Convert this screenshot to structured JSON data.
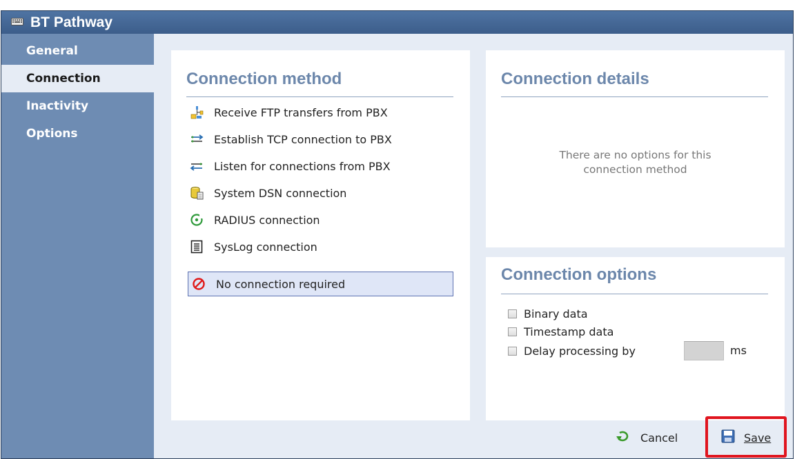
{
  "window": {
    "title": "BT Pathway",
    "app_icon": "keyboard-icon"
  },
  "sidebar": {
    "items": [
      {
        "label": "General"
      },
      {
        "label": "Connection"
      },
      {
        "label": "Inactivity"
      },
      {
        "label": "Options"
      }
    ],
    "active": "Connection"
  },
  "connection_method": {
    "heading": "Connection method",
    "items": [
      {
        "label": "Receive FTP transfers from PBX",
        "icon": "ftp-transfer-icon"
      },
      {
        "label": "Establish TCP connection to PBX",
        "icon": "tcp-connect-icon"
      },
      {
        "label": "Listen for connections from PBX",
        "icon": "tcp-listen-icon"
      },
      {
        "label": "System DSN connection",
        "icon": "database-icon"
      },
      {
        "label": "RADIUS connection",
        "icon": "radius-icon"
      },
      {
        "label": "SysLog connection",
        "icon": "syslog-document-icon"
      },
      {
        "label": "No connection required",
        "icon": "no-entry-icon"
      }
    ],
    "selected": "No connection required"
  },
  "connection_details": {
    "heading": "Connection details",
    "message_line1": "There are no options for this",
    "message_line2": "connection method"
  },
  "connection_options": {
    "heading": "Connection options",
    "binary_label": "Binary data",
    "timestamp_label": "Timestamp data",
    "delay_label": "Delay processing by",
    "delay_value": "",
    "delay_unit": "ms"
  },
  "footer": {
    "cancel_label": "Cancel",
    "save_label": "Save"
  },
  "colors": {
    "titlebar": "#3f5f8c",
    "sidebar": "#6e8cb3",
    "content_bg": "#e6ecf5",
    "heading": "#6c87ab",
    "highlight": "#e0141e"
  }
}
